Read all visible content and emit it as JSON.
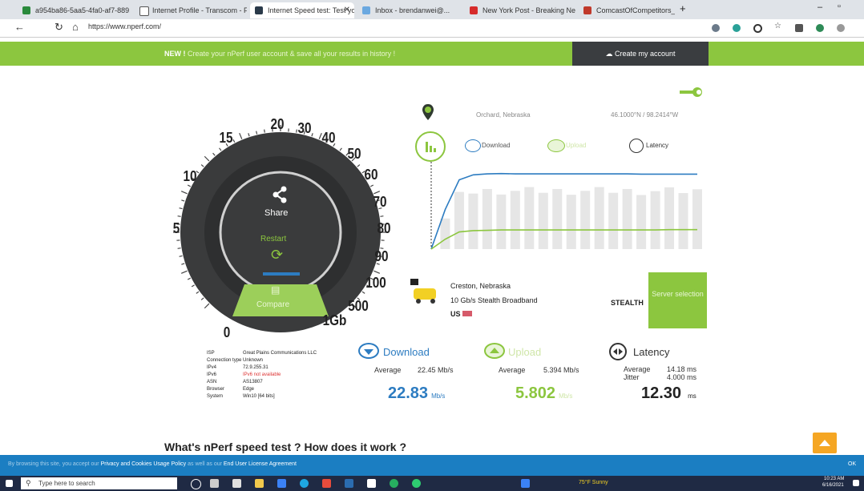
{
  "browser": {
    "tabs": [
      {
        "label": "a954ba86-5aa5-4fa0-af7-889..."
      },
      {
        "label": "Internet Profile - Transcom - Fi..."
      },
      {
        "label": "Internet Speed test: Test your i...",
        "active": true
      },
      {
        "label": "Inbox - brendanwei@..."
      },
      {
        "label": "New York Post - Breaking New..."
      },
      {
        "label": "ComcastOfCompetitors_Count..."
      }
    ],
    "new_tab": "+",
    "url": "https://www.nperf.com/",
    "back": "←",
    "reload": "↻",
    "home": "⌂"
  },
  "banner": {
    "new_label": "NEW !",
    "text": "Create your nPerf user account & save all your results in history !",
    "create_account": "Create my account"
  },
  "gauge": {
    "labels": [
      "0",
      "5",
      "10",
      "15",
      "20",
      "30",
      "40",
      "50",
      "60",
      "70",
      "80",
      "90",
      "100",
      "500",
      "1Gb"
    ],
    "share": "Share",
    "restart": "Restart",
    "compare": "Compare"
  },
  "location": {
    "city": "Orchard, Nebraska",
    "coords": "46.1000°N / 98.2414°W"
  },
  "chart_legend": {
    "download": "Download",
    "upload": "Upload",
    "latency": "Latency"
  },
  "chart_data": {
    "type": "line",
    "series": [
      {
        "name": "Download",
        "color": "#2d7cc1",
        "values": [
          0,
          12,
          21,
          22.5,
          22.8,
          22.9,
          22.8,
          22.8,
          22.8,
          22.8,
          22.8,
          22.8,
          22.8,
          22.8,
          22.8,
          22.7,
          22.7,
          22.7,
          22.7,
          22.7
        ]
      },
      {
        "name": "Upload",
        "color": "#8cc63f",
        "values": [
          0,
          3,
          5.2,
          5.6,
          5.7,
          5.8,
          5.8,
          5.8,
          5.8,
          5.8,
          5.8,
          5.8,
          5.8,
          5.8,
          5.8,
          5.8,
          5.8,
          5.9,
          5.9,
          5.9
        ]
      }
    ]
  },
  "server": {
    "city": "Creston, Nebraska",
    "provider": "10 Gb/s Stealth Broadband",
    "country": "US",
    "provider_logo_text": "STEALTH",
    "button": "Server selection"
  },
  "connection_info": {
    "rows": [
      {
        "label": "ISP",
        "value": "Great Plains Communications LLC"
      },
      {
        "label": "Connection type",
        "value": "Unknown"
      },
      {
        "label": "IPv4",
        "value": "72.9.255.31"
      },
      {
        "label": "IPv6",
        "value": "IPv6 not available",
        "red": true
      },
      {
        "label": "ASN",
        "value": "AS13807"
      },
      {
        "label": "Browser",
        "value": "Edge"
      },
      {
        "label": "System",
        "value": "Win10 [64 bits]"
      }
    ]
  },
  "results": {
    "download": {
      "title": "Download",
      "avg_label": "Average",
      "avg_value": "22.45 Mb/s",
      "value": "22.83",
      "unit": "Mb/s"
    },
    "upload": {
      "title": "Upload",
      "avg_label": "Average",
      "avg_value": "5.394 Mb/s",
      "value": "5.802",
      "unit": "Mb/s"
    },
    "latency": {
      "title": "Latency",
      "avg_label": "Average",
      "avg_value": "14.18 ms",
      "jitter_label": "Jitter",
      "jitter_value": "4.000 ms",
      "value": "12.30",
      "unit": "ms"
    }
  },
  "how_works": "What's nPerf speed test ? How does it work ?",
  "cookie": {
    "text_pre": "By browsing this site, you accept our",
    "privacy": "Privacy and Cookies Usage Policy",
    "text_mid": "as well as our",
    "eula": "End User License Agreement",
    "ok": "OK"
  },
  "taskbar": {
    "search_placeholder": "Type here to search",
    "weather": "75°F Sunny",
    "time": "10:23 AM",
    "date": "6/16/2021"
  }
}
